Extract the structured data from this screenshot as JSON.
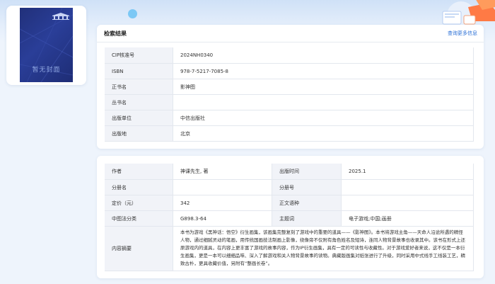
{
  "cover": {
    "placeholder_text": "暂无封面",
    "publisher_logo": "publisher-logo"
  },
  "search_result": {
    "title": "检索结果",
    "more_link": "查询更多信息",
    "rows": [
      {
        "label": "CIP核准号",
        "value": "2024NH0340"
      },
      {
        "label": "ISBN",
        "value": "978-7-5217-7085-8"
      },
      {
        "label": "正书名",
        "value": "影神图"
      },
      {
        "label": "丛书名",
        "value": ""
      },
      {
        "label": "出版单位",
        "value": "中信出版社"
      },
      {
        "label": "出版地",
        "value": "北京"
      }
    ]
  },
  "details": {
    "author_label": "作者",
    "author": "神课先生, 著",
    "pubtime_label": "出版时间",
    "pubtime": "2025.1",
    "volume_name_label": "分册名",
    "volume_name": "",
    "volume_no_label": "分册号",
    "volume_no": "",
    "price_label": "定价（元）",
    "price": "342",
    "language_label": "正文语种",
    "language": "",
    "clc_label": "中图法分类",
    "clc": "G898.3-64",
    "subject_label": "主题词",
    "subject": "电子游戏;中国;画册",
    "summary_label": "内容摘要",
    "summary": "本书为游戏《黑神话：悟空》衍生画集，该画集完整复刻了游戏中的重要的道具——《影神图》。本书将游戏主角——天命人沿途所遇的精怪人物，通过细腻灵动的笔画，用传统国画技法制画上影像，绕像旁不仅附有角色姓名及短诗，连同人物背景故事也收录其中。该书在形式上还原游戏内的道具，在内容上更丰富了游戏的故事内容，作为IP衍生画集，具有一定的可读性与收藏性。对于游戏爱好者来说，这不仅是一本衍生画集，更是一本可以细细品味、深入了解游戏和关人物背景故事的读物。典藏版画集对纸张进行了升级，同时采用中式线手工线装工艺，精致古朴，更具收藏价值，另附有“整画长卷”。"
  },
  "colors": {
    "link": "#2a6fd6",
    "label_bg": "#f1f3f8",
    "page_bg": "#eef4fc"
  }
}
